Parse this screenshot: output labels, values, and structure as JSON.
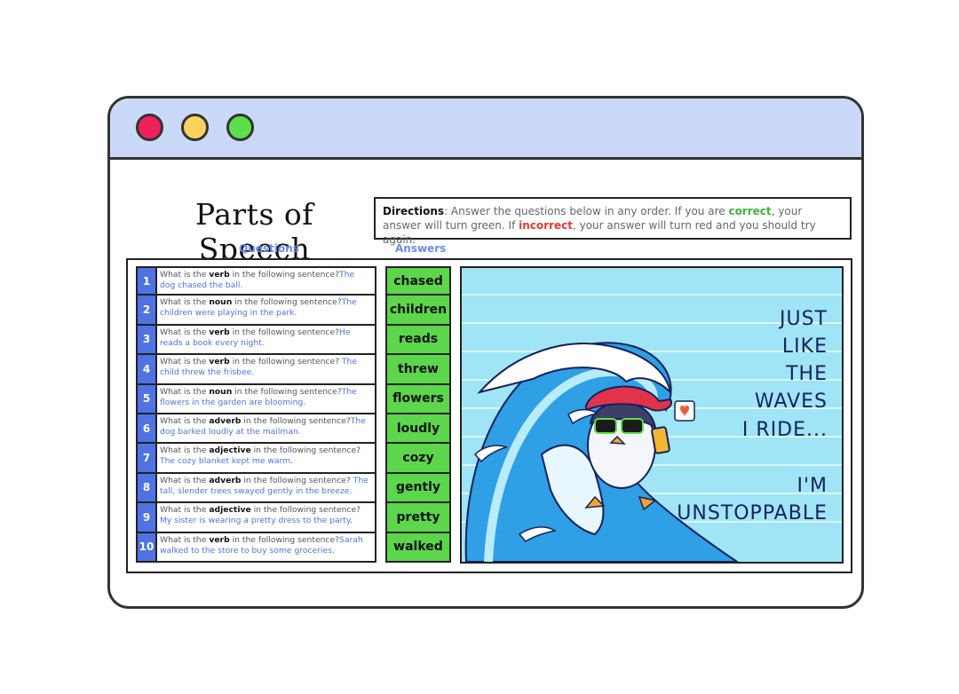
{
  "window": {
    "controls": [
      "close",
      "minimize",
      "maximize"
    ]
  },
  "title": "Parts of Speech",
  "directions": {
    "label": "Directions",
    "text1": ":  Answer the questions below in any order.  If you are ",
    "correct": "correct",
    "text2": ", your answer will turn green.  If ",
    "incorrect": "incorrect",
    "text3": ", your answer will turn red and you should try again."
  },
  "headers": {
    "questions": "Questions",
    "answers": "Answers"
  },
  "questions": [
    {
      "num": "1",
      "prefix": "What is the ",
      "part": "verb",
      "suffix": " in the following sentence?",
      "sentence": "The dog chased the ball."
    },
    {
      "num": "2",
      "prefix": "What is the ",
      "part": "noun",
      "suffix": " in the following sentence?",
      "sentence": "The children were playing in the park."
    },
    {
      "num": "3",
      "prefix": "What is the ",
      "part": "verb",
      "suffix": " in the following sentence?",
      "sentence": "He reads a book every night."
    },
    {
      "num": "4",
      "prefix": "What is the ",
      "part": "verb",
      "suffix": " in the following sentence? ",
      "sentence": "The child threw the frisbee."
    },
    {
      "num": "5",
      "prefix": "What is the ",
      "part": "noun",
      "suffix": " in the following sentence?",
      "sentence": "The flowers in the garden are blooming."
    },
    {
      "num": "6",
      "prefix": "What is the ",
      "part": "adverb",
      "suffix": " in the following sentence?",
      "sentence": "The dog barked loudly at the mailman."
    },
    {
      "num": "7",
      "prefix": "What is the ",
      "part": "adjective",
      "suffix": " in the following sentence?",
      "sentence": "The cozy blanket kept me warm."
    },
    {
      "num": "8",
      "prefix": "What is the ",
      "part": "adverb",
      "suffix": " in the following sentence?  ",
      "sentence": "The tall, slender trees swayed gently in the breeze."
    },
    {
      "num": "9",
      "prefix": "What is the ",
      "part": "adjective",
      "suffix": " in the following sentence?",
      "sentence": "My sister is wearing a pretty dress to the party."
    },
    {
      "num": "10",
      "prefix": "What is the ",
      "part": "verb",
      "suffix": " in the following sentence?",
      "sentence": "Sarah walked to the store to buy some groceries."
    }
  ],
  "answers": [
    "chased",
    "children",
    "reads",
    "threw",
    "flowers",
    "loudly",
    "cozy",
    "gently",
    "pretty",
    "walked"
  ],
  "reward": {
    "lines": [
      "JUST",
      "LIKE",
      "THE",
      "WAVES",
      "I RIDE...",
      "I'M",
      "UNSTOPPABLE"
    ]
  },
  "colors": {
    "titlebar": "#c9d9f7",
    "close": "#f0215a",
    "minimize": "#ffd25e",
    "maximize": "#5ce04a",
    "answer_bg": "#5cd64a",
    "number_bg": "#4f73e3",
    "reward_bg": "#9fe5f6"
  }
}
